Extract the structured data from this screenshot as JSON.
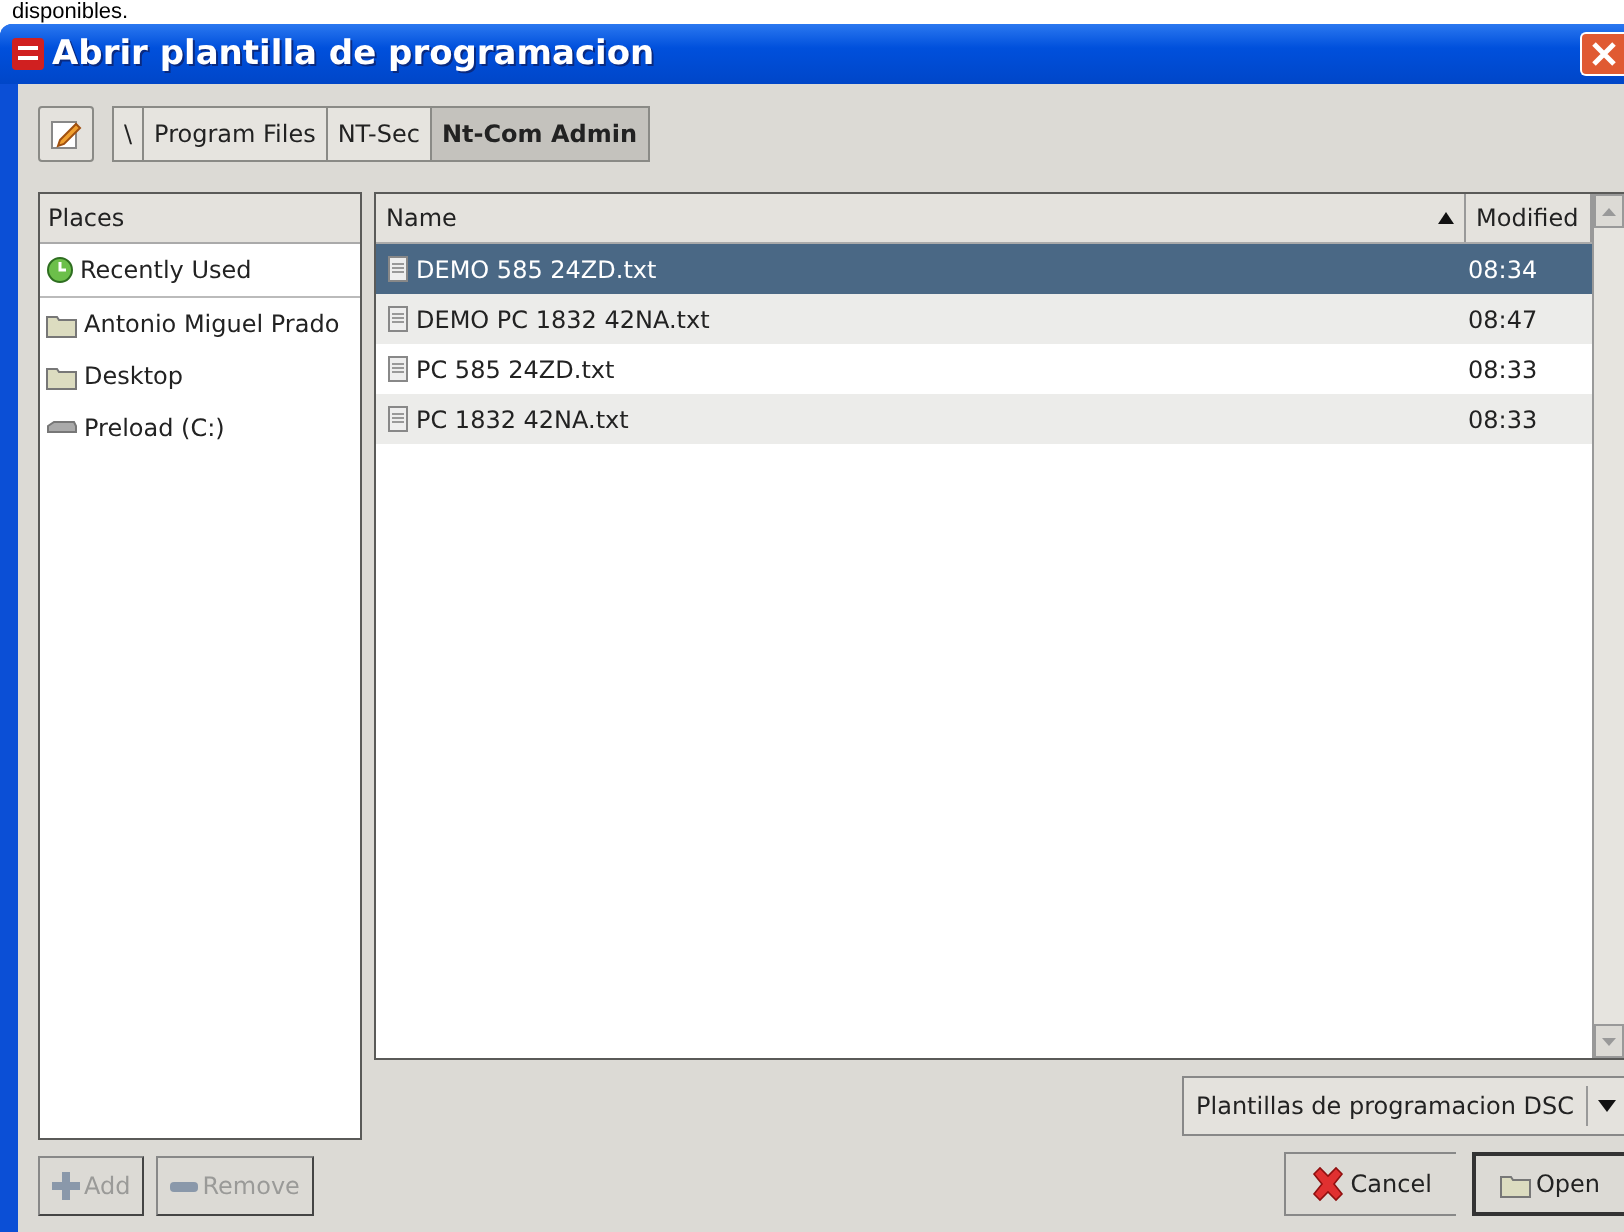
{
  "page_caption": "disponibles.",
  "window": {
    "title": "Abrir plantilla de programacion"
  },
  "path_bar": {
    "segments": [
      {
        "label": "\\",
        "selected": false
      },
      {
        "label": "Program Files",
        "selected": false
      },
      {
        "label": "NT-Sec",
        "selected": false
      },
      {
        "label": "Nt-Com Admin",
        "selected": true
      }
    ]
  },
  "places": {
    "header": "Places",
    "items": [
      {
        "label": "Recently Used",
        "kind": "recent"
      },
      {
        "label": "Antonio Miguel Prado",
        "kind": "folder"
      },
      {
        "label": "Desktop",
        "kind": "folder"
      },
      {
        "label": "Preload (C:)",
        "kind": "drive"
      }
    ],
    "buttons": [
      {
        "label": "Add",
        "kind": "add",
        "disabled": true
      },
      {
        "label": "Remove",
        "kind": "remove",
        "disabled": true
      }
    ]
  },
  "files": {
    "columns": [
      {
        "label": "Name",
        "sort_ascending": true
      },
      {
        "label": "Modified"
      }
    ],
    "rows": [
      {
        "name": "DEMO 585 24ZD.txt",
        "modified": "08:34",
        "selected": true
      },
      {
        "name": "DEMO PC 1832 42NA.txt",
        "modified": "08:47",
        "selected": false
      },
      {
        "name": "PC 585 24ZD.txt",
        "modified": "08:33",
        "selected": false
      },
      {
        "name": "PC 1832 42NA.txt",
        "modified": "08:33",
        "selected": false
      }
    ]
  },
  "filter": {
    "value": "Plantillas de programacion DSC"
  },
  "buttons": [
    {
      "label": "Cancel",
      "kind": "cancel"
    },
    {
      "label": "Open",
      "kind": "open"
    }
  ]
}
